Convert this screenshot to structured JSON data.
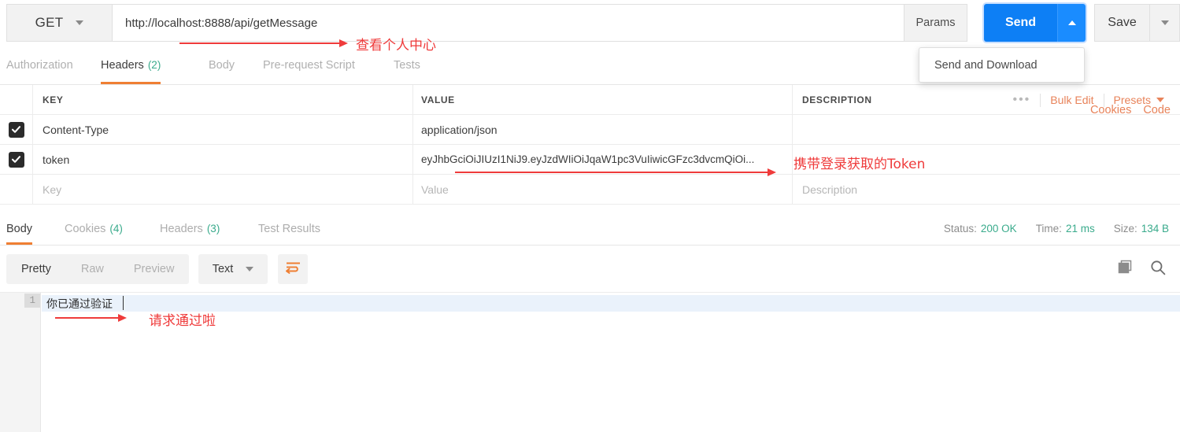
{
  "request": {
    "method": "GET",
    "url": "http://localhost:8888/api/getMessage",
    "params_label": "Params",
    "send_label": "Send",
    "save_label": "Save",
    "send_dropdown_item": "Send and Download",
    "tabs": [
      {
        "label": "Authorization",
        "count": "",
        "active": false
      },
      {
        "label": "Headers",
        "count": "(2)",
        "active": true
      },
      {
        "label": "Body",
        "count": "",
        "active": false
      },
      {
        "label": "Pre-request Script",
        "count": "",
        "active": false
      },
      {
        "label": "Tests",
        "count": "",
        "active": false
      }
    ],
    "links": [
      "Cookies",
      "Code"
    ]
  },
  "headers_table": {
    "columns": [
      "KEY",
      "VALUE",
      "DESCRIPTION"
    ],
    "toolbar": {
      "dots": "•••",
      "bulk_edit": "Bulk Edit",
      "presets": "Presets"
    },
    "rows": [
      {
        "checked": true,
        "key": "Content-Type",
        "value": "application/json",
        "description": ""
      },
      {
        "checked": true,
        "key": "token",
        "value": "eyJhbGciOiJIUzI1NiJ9.eyJzdWIiOiJqaW1pc3VuIiwicGFzc3dvcmQiOi...",
        "description": ""
      }
    ],
    "placeholder_row": {
      "key": "Key",
      "value": "Value",
      "description": "Description"
    }
  },
  "response": {
    "tabs": [
      {
        "label": "Body",
        "count": "",
        "active": true
      },
      {
        "label": "Cookies",
        "count": "(4)",
        "active": false
      },
      {
        "label": "Headers",
        "count": "(3)",
        "active": false
      },
      {
        "label": "Test Results",
        "count": "",
        "active": false
      }
    ],
    "meta": {
      "status_label": "Status:",
      "status_value": "200 OK",
      "time_label": "Time:",
      "time_value": "21 ms",
      "size_label": "Size:",
      "size_value": "134 B"
    },
    "view_modes": [
      "Pretty",
      "Raw",
      "Preview"
    ],
    "active_view": "Pretty",
    "format": "Text",
    "line_number": "1",
    "body_text": "你已通过验证"
  },
  "annotations": [
    {
      "text": "查看个人中心"
    },
    {
      "text": "携带登录获取的Token"
    },
    {
      "text": "请求通过啦"
    }
  ],
  "colors": {
    "accent_orange": "#ef7f33",
    "link_orange": "#e8835a",
    "send_blue": "#0d7ff5",
    "green": "#3aab8c",
    "annotation_red": "#ef3b3b"
  }
}
